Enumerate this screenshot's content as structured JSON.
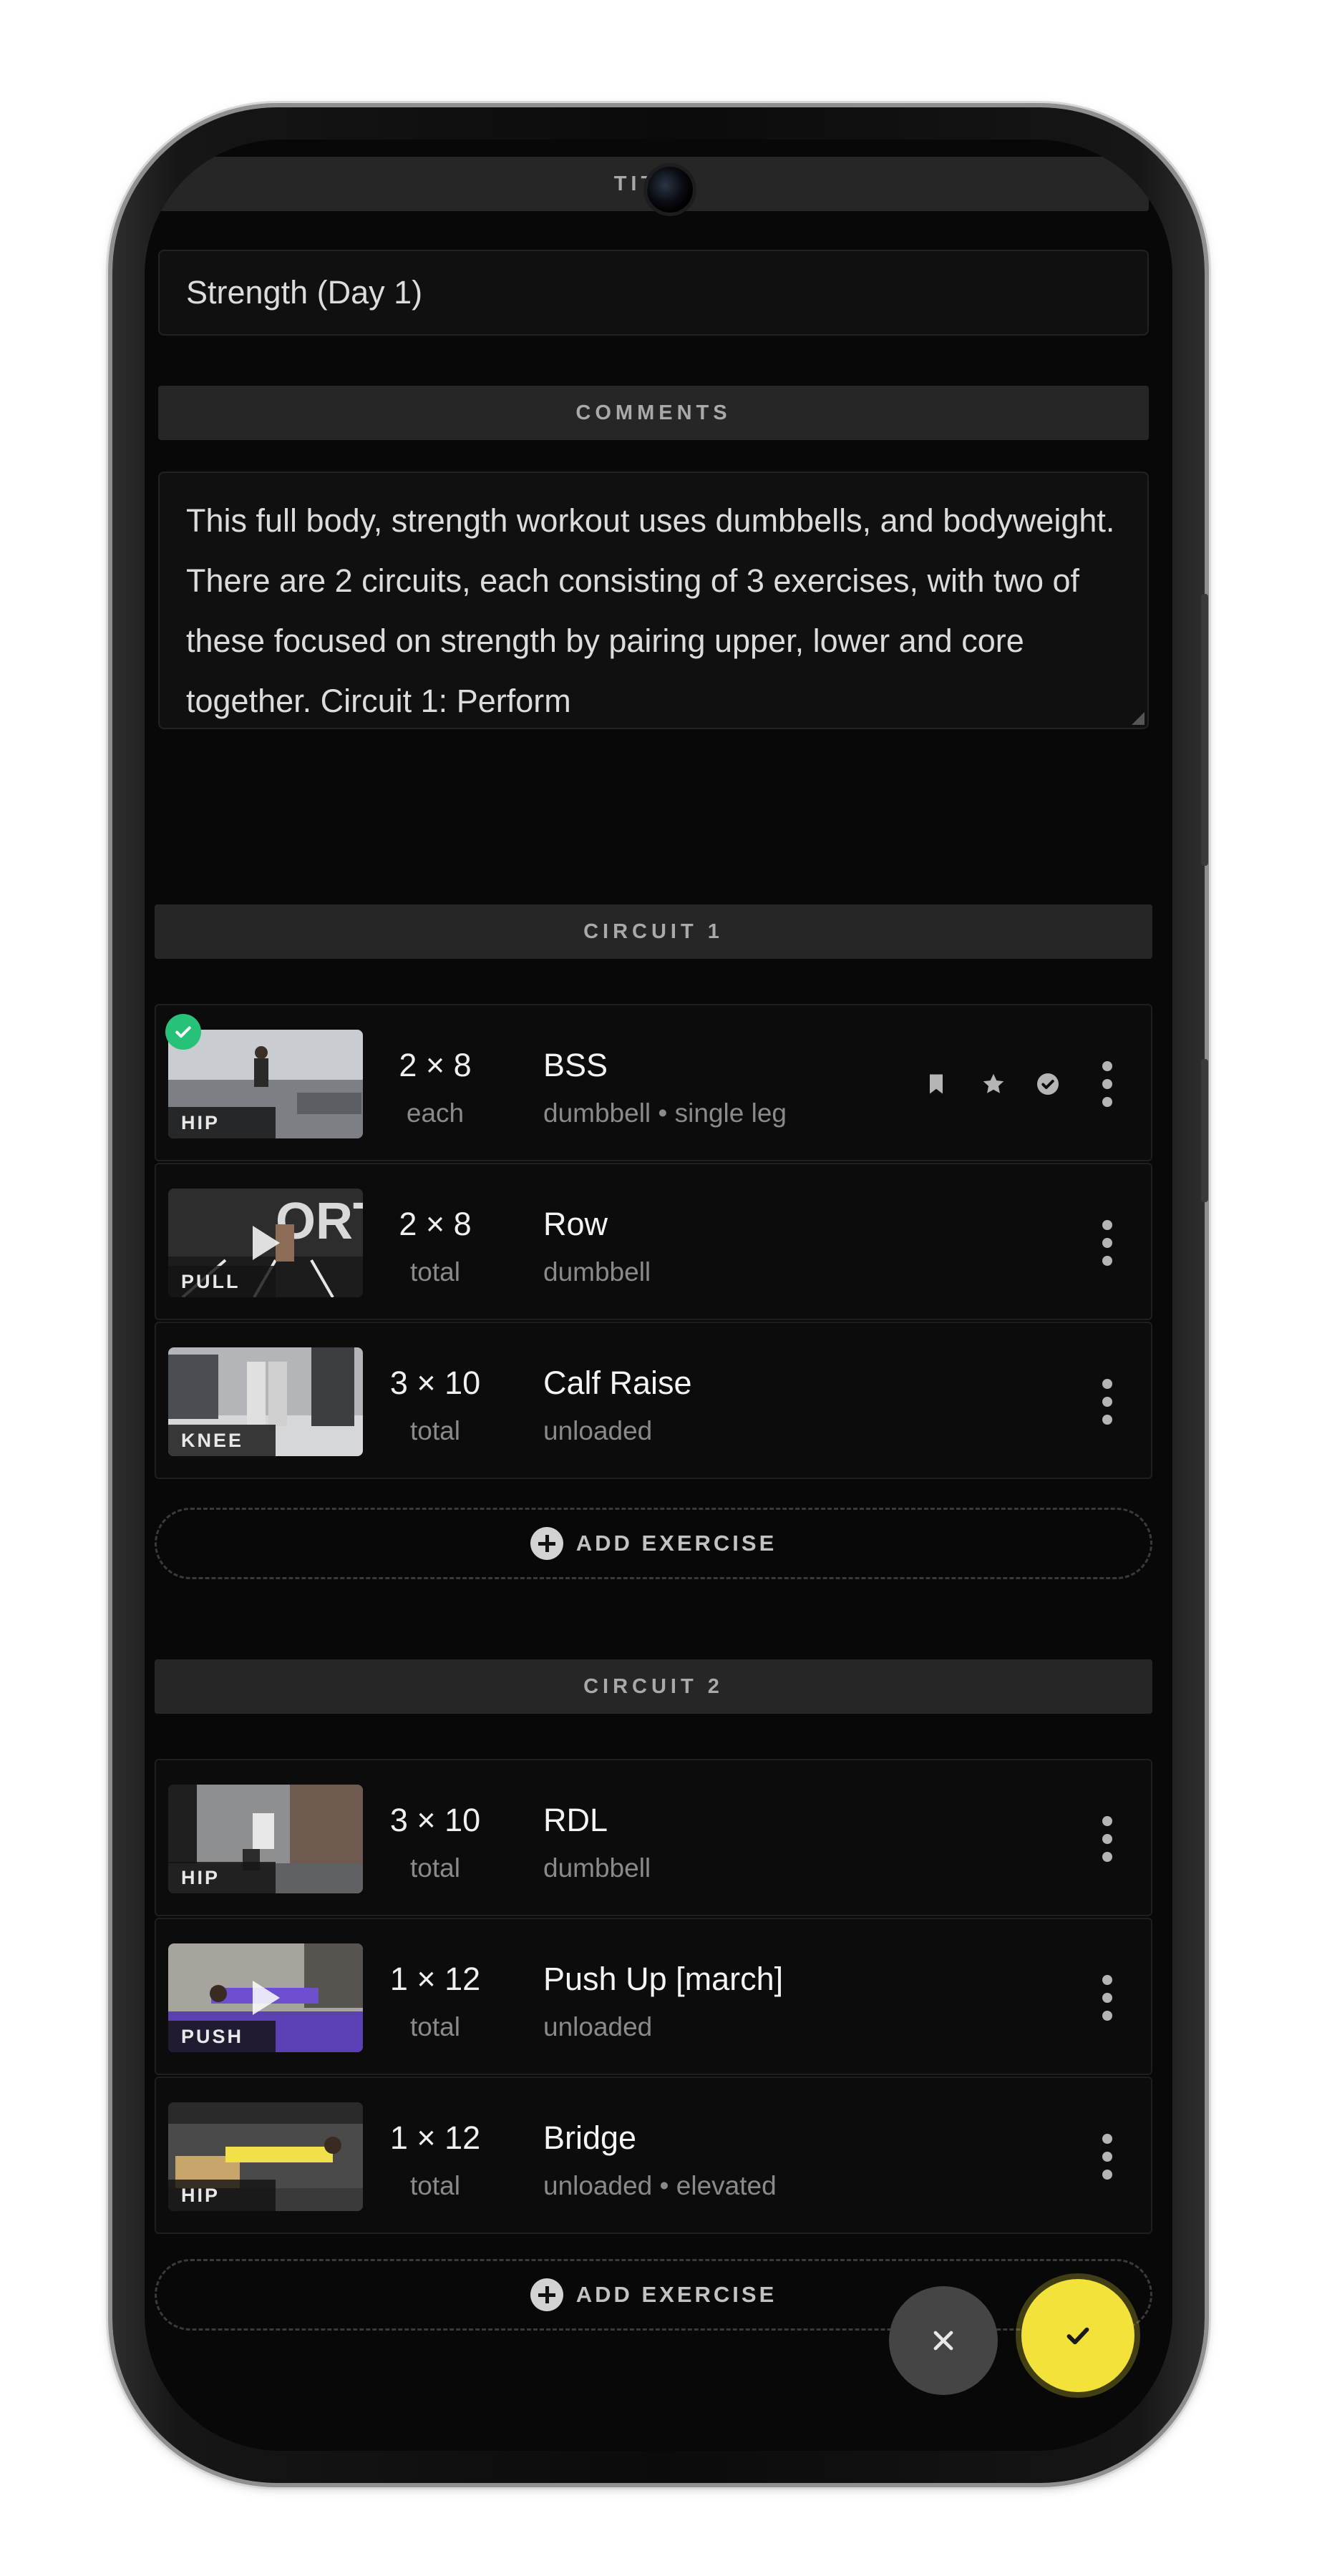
{
  "form": {
    "title_label": "TITLE",
    "title_value": "Strength (Day 1)",
    "comments_label": "COMMENTS",
    "comments_value": "This full body, strength workout uses dumbbells, and bodyweight. There are 2 circuits, each consisting of 3 exercises, with two of these focused on strength by pairing upper, lower and core together. Circuit 1: Perform"
  },
  "circuits": [
    {
      "label": "CIRCUIT 1",
      "add_label": "ADD EXERCISE",
      "exercises": [
        {
          "tag": "HIP",
          "sets": "2 × 8",
          "unit": "each",
          "name": "BSS",
          "details": "dumbbell • single leg",
          "completed": true,
          "icons": [
            "bookmark-icon",
            "star-icon",
            "check-circle-icon"
          ]
        },
        {
          "tag": "PULL",
          "sets": "2 × 8",
          "unit": "total",
          "name": "Row",
          "details": "dumbbell"
        },
        {
          "tag": "KNEE",
          "sets": "3 × 10",
          "unit": "total",
          "name": "Calf Raise",
          "details": "unloaded"
        }
      ]
    },
    {
      "label": "CIRCUIT 2",
      "add_label": "ADD EXERCISE",
      "exercises": [
        {
          "tag": "HIP",
          "sets": "3 × 10",
          "unit": "total",
          "name": "RDL",
          "details": "dumbbell"
        },
        {
          "tag": "PUSH",
          "sets": "1 × 12",
          "unit": "total",
          "name": "Push Up [march]",
          "details": "unloaded"
        },
        {
          "tag": "HIP",
          "sets": "1 × 12",
          "unit": "total",
          "name": "Bridge",
          "details": "unloaded • elevated"
        }
      ]
    }
  ],
  "actions": {
    "cancel_icon": "close-icon",
    "confirm_icon": "check-icon"
  },
  "colors": {
    "background": "#080808",
    "accent": "#f2e23a",
    "success": "#26c27a",
    "section_bar": "#262626"
  }
}
